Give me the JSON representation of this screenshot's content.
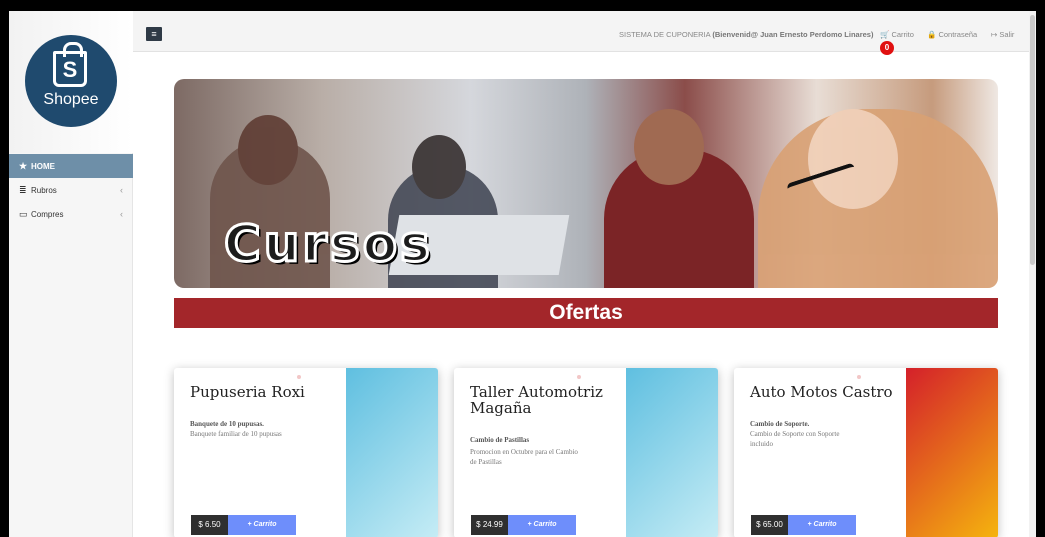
{
  "brand": {
    "name": "Shopee"
  },
  "sidebar": {
    "items": [
      {
        "label": "HOME",
        "icon": "star-icon",
        "active": true
      },
      {
        "label": "Rubros",
        "icon": "list-icon",
        "active": false
      },
      {
        "label": "Compres",
        "icon": "card-icon",
        "active": false
      }
    ]
  },
  "topbar": {
    "menu_icon": "bars-icon",
    "system": "SISTEMA DE CUPONERIA",
    "welcome": "(Bienvenid@ Juan Ernesto Perdomo Linares)",
    "cart": "Carrito",
    "cart_count": "0",
    "password": "Contraseña",
    "exit": "Salir"
  },
  "hero": {
    "title": "Cursos"
  },
  "offers_heading": "Ofertas",
  "cards": [
    {
      "title": "Pupuseria Roxi",
      "subtitle": "Banquete de 10 pupusas.",
      "description": "Banquete familiar de 10 pupusas",
      "price": "$ 6.50",
      "button": "+ Carrito",
      "media_colors": [
        "#5fbfe0",
        "#c5ecf5"
      ]
    },
    {
      "title": "Taller Automotriz Magaña",
      "subtitle": "Cambio de Pastillas",
      "description": "Promocion en Octubre para el Cambio de Pastillas",
      "price": "$ 24.99",
      "button": "+ Carrito",
      "media_colors": [
        "#5fbfe0",
        "#c5ecf5"
      ]
    },
    {
      "title": "Auto Motos Castro",
      "subtitle": "Cambio de Soporte.",
      "description": "Cambio de Soporte con Soporte incluido",
      "price": "$ 65.00",
      "button": "+ Carrito",
      "media_colors": [
        "#d4202a",
        "#f5b40e"
      ]
    }
  ]
}
